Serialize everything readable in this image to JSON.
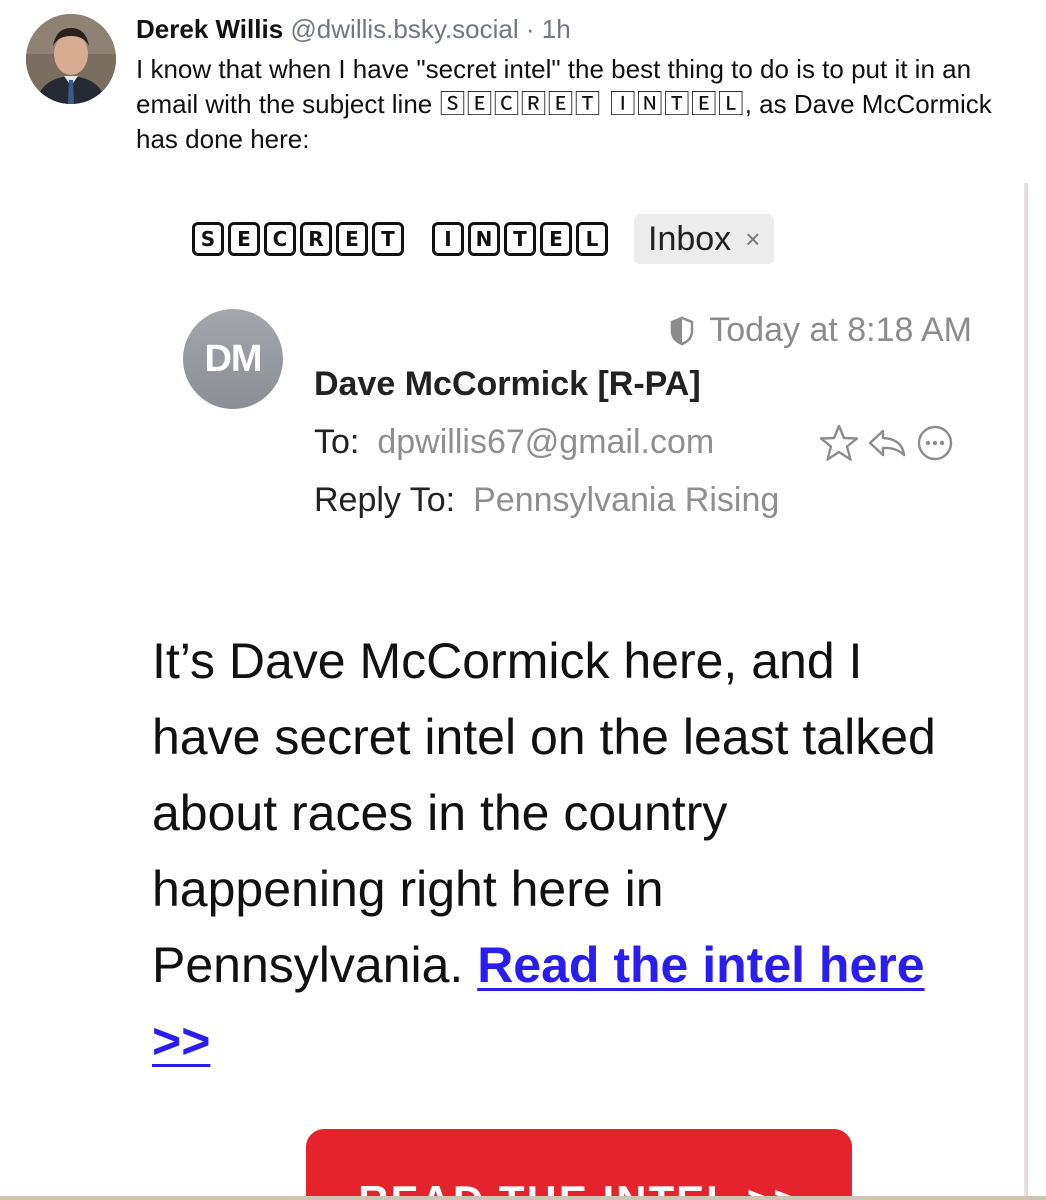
{
  "post": {
    "author_name": "Derek Willis",
    "author_handle": "@dwillis.bsky.social",
    "separator": "·",
    "time": "1h",
    "text_before": "I know that when I have \"secret intel\" the best thing to do is to put it in an email with the subject line ",
    "text_boxed": "🅂🄴🄲🅁🄴🅃 🄸🄽🅃🄴🄻",
    "text_after": ", as Dave McCormick has done here:"
  },
  "email": {
    "subject_letters": {
      "word1": [
        "S",
        "E",
        "C",
        "R",
        "E",
        "T"
      ],
      "word2": [
        "I",
        "N",
        "T",
        "E",
        "L"
      ]
    },
    "inbox_label": "Inbox",
    "inbox_close": "×",
    "sender_initials": "DM",
    "timestamp": "Today at 8:18 AM",
    "sender_name": "Dave McCormick [R-PA]",
    "to_label": "To:",
    "to_value": "dpwillis67@gmail.com",
    "reply_to_label": "Reply To:",
    "reply_to_value": "Pennsylvania Rising",
    "body_text": "It’s Dave McCormick here, and I have secret intel on the least talked about races in the country happening right here in Pennsylvania. ",
    "body_link": "Read the intel here >>",
    "cta_label": "READ THE INTEL >>"
  },
  "icons": {
    "timestamp_icon": "half-shield-icon",
    "actions": [
      "star-icon",
      "reply-icon",
      "more-icon"
    ]
  },
  "colors": {
    "link": "#2b1cf0",
    "cta": "#e4232d",
    "muted": "#8f8f8f",
    "avatar_gray": "#999ba2"
  }
}
